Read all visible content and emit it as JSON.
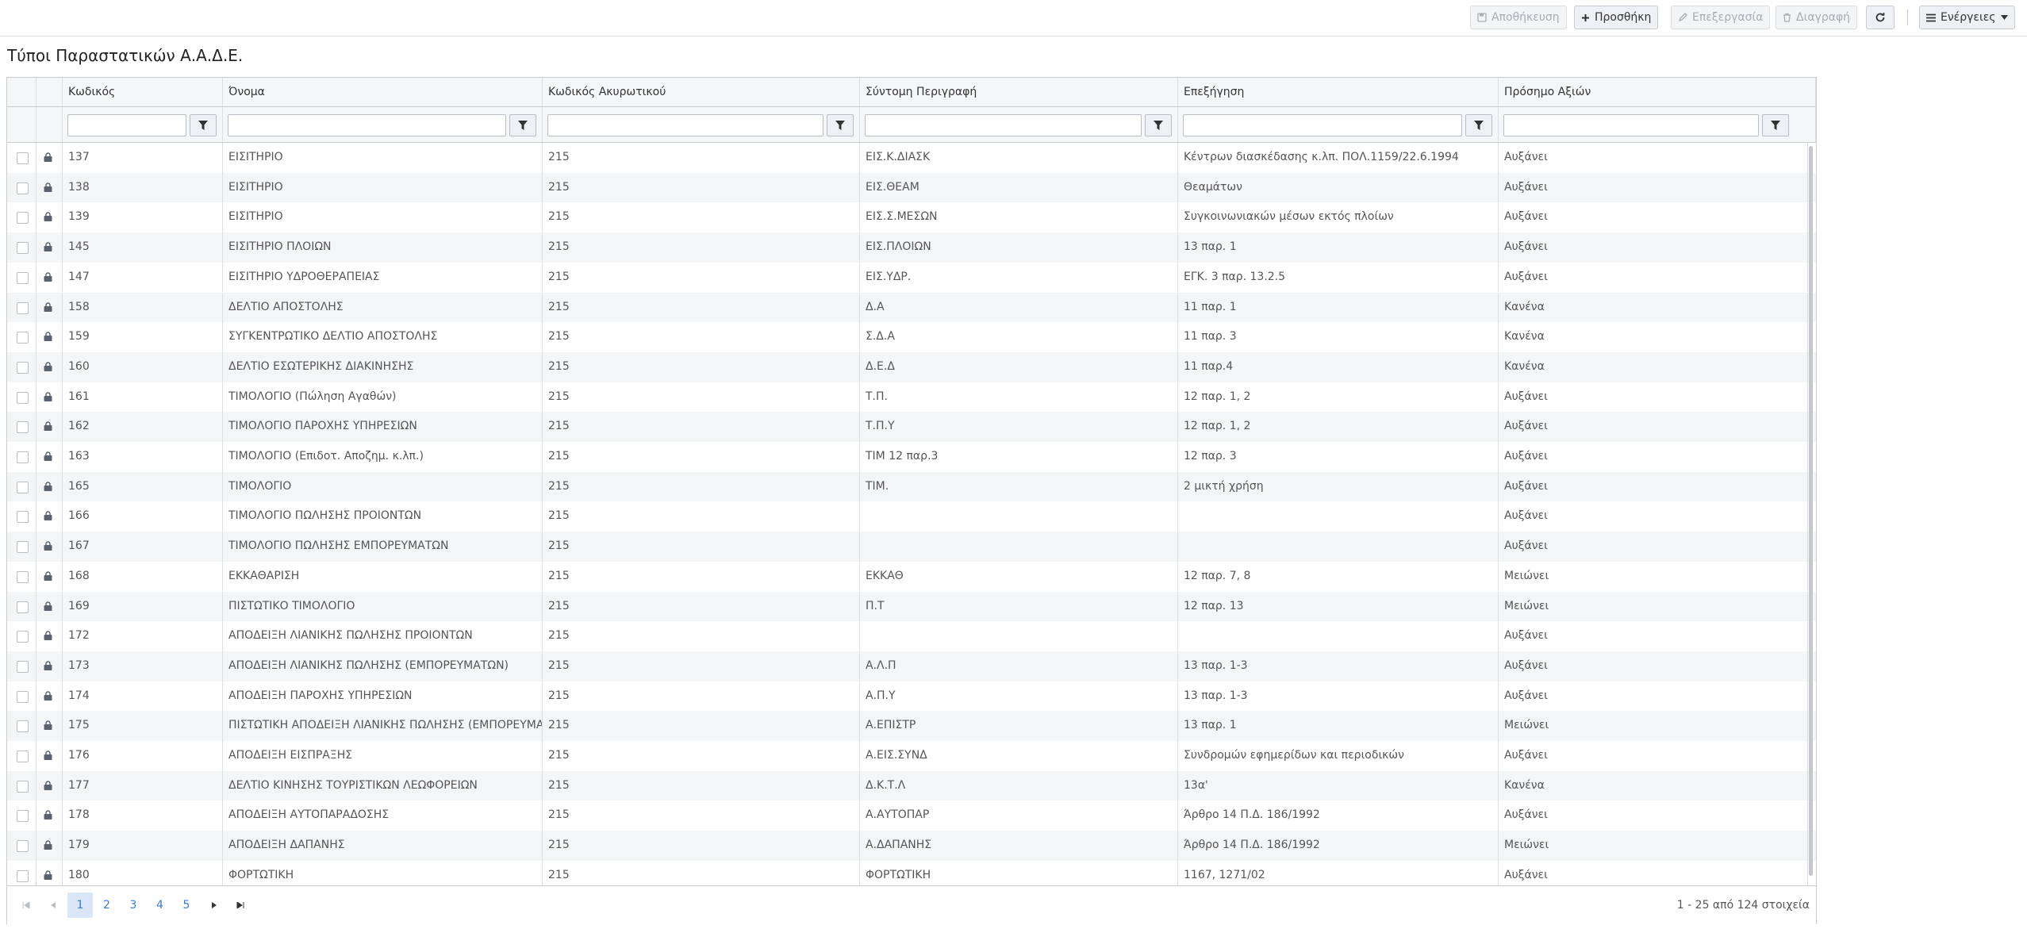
{
  "toolbar": {
    "save_label": "Αποθήκευση",
    "add_label": "Προσθήκη",
    "edit_label": "Επεξεργασία",
    "delete_label": "Διαγραφή",
    "actions_label": "Ενέργειες"
  },
  "page": {
    "title": "Τύποι Παραστατικών Α.Α.Δ.Ε."
  },
  "grid": {
    "columns": [
      "Κωδικός",
      "Όνομα",
      "Κωδικός Ακυρωτικού",
      "Σύντομη Περιγραφή",
      "Επεξήγηση",
      "Πρόσημο Αξιών"
    ],
    "rows": [
      [
        "137",
        "ΕΙΣΙΤΗΡΙΟ",
        "215",
        "ΕΙΣ.Κ.ΔΙΑΣΚ",
        "Κέντρων διασκέδασης κ.λπ. ΠΟΛ.1159/22.6.1994",
        "Αυξάνει"
      ],
      [
        "138",
        "ΕΙΣΙΤΗΡΙΟ",
        "215",
        "ΕΙΣ.ΘΕΑΜ",
        "Θεαμάτων",
        "Αυξάνει"
      ],
      [
        "139",
        "ΕΙΣΙΤΗΡΙΟ",
        "215",
        "ΕΙΣ.Σ.ΜΕΣΩΝ",
        "Συγκοινωνιακών μέσων εκτός πλοίων",
        "Αυξάνει"
      ],
      [
        "145",
        "ΕΙΣΙΤΗΡΙΟ ΠΛΟΙΩΝ",
        "215",
        "ΕΙΣ.ΠΛΟΙΩΝ",
        "13 παρ. 1",
        "Αυξάνει"
      ],
      [
        "147",
        "ΕΙΣΙΤΗΡΙΟ ΥΔΡΟΘΕΡΑΠΕΙΑΣ",
        "215",
        "ΕΙΣ.ΥΔΡ.",
        "ΕΓΚ. 3 παρ. 13.2.5",
        "Αυξάνει"
      ],
      [
        "158",
        "ΔΕΛΤΙΟ ΑΠΟΣΤΟΛΗΣ",
        "215",
        "Δ.Α",
        "11 παρ. 1",
        "Κανένα"
      ],
      [
        "159",
        "ΣΥΓΚΕΝΤΡΩΤΙΚΟ ΔΕΛΤΙΟ ΑΠΟΣΤΟΛΗΣ",
        "215",
        "Σ.Δ.Α",
        "11 παρ. 3",
        "Κανένα"
      ],
      [
        "160",
        "ΔΕΛΤΙΟ ΕΣΩΤΕΡΙΚΗΣ ΔΙΑΚΙΝΗΣΗΣ",
        "215",
        "Δ.Ε.Δ",
        "11 παρ.4",
        "Κανένα"
      ],
      [
        "161",
        "ΤΙΜΟΛΟΓΙΟ (Πώληση Αγαθών)",
        "215",
        "Τ.Π.",
        "12 παρ. 1, 2",
        "Αυξάνει"
      ],
      [
        "162",
        "ΤΙΜΟΛΟΓΙΟ ΠΑΡΟΧΗΣ ΥΠΗΡΕΣΙΩΝ",
        "215",
        "Τ.Π.Υ",
        "12 παρ. 1, 2",
        "Αυξάνει"
      ],
      [
        "163",
        "ΤΙΜΟΛΟΓΙΟ (Επιδοτ. Αποζημ. κ.λπ.)",
        "215",
        "ΤΙΜ 12 παρ.3",
        "12 παρ. 3",
        "Αυξάνει"
      ],
      [
        "165",
        "ΤΙΜΟΛΟΓΙΟ",
        "215",
        "ΤΙΜ.",
        "2 μικτή χρήση",
        "Αυξάνει"
      ],
      [
        "166",
        "ΤΙΜΟΛΟΓΙΟ ΠΩΛΗΣΗΣ ΠΡΟΙΟΝΤΩΝ",
        "215",
        "",
        "",
        "Αυξάνει"
      ],
      [
        "167",
        "ΤΙΜΟΛΟΓΙΟ ΠΩΛΗΣΗΣ ΕΜΠΟΡΕΥΜΑΤΩΝ",
        "215",
        "",
        "",
        "Αυξάνει"
      ],
      [
        "168",
        "ΕΚΚΑΘΑΡΙΣΗ",
        "215",
        "ΕΚΚΑΘ",
        "12 παρ. 7, 8",
        "Μειώνει"
      ],
      [
        "169",
        "ΠΙΣΤΩΤΙΚΟ ΤΙΜΟΛΟΓΙΟ",
        "215",
        "Π.Τ",
        "12 παρ. 13",
        "Μειώνει"
      ],
      [
        "172",
        "ΑΠΟΔΕΙΞΗ ΛΙΑΝΙΚΗΣ ΠΩΛΗΣΗΣ ΠΡΟΙΟΝΤΩΝ",
        "215",
        "",
        "",
        "Αυξάνει"
      ],
      [
        "173",
        "ΑΠΟΔΕΙΞΗ ΛΙΑΝΙΚΗΣ ΠΩΛΗΣΗΣ (ΕΜΠΟΡΕΥΜΑΤΩΝ)",
        "215",
        "Α.Λ.Π",
        "13 παρ. 1-3",
        "Αυξάνει"
      ],
      [
        "174",
        "ΑΠΟΔΕΙΞΗ ΠΑΡΟΧΗΣ ΥΠΗΡΕΣΙΩΝ",
        "215",
        "Α.Π.Υ",
        "13 παρ. 1-3",
        "Αυξάνει"
      ],
      [
        "175",
        "ΠΙΣΤΩΤΙΚΗ ΑΠΟΔΕΙΞΗ ΛΙΑΝΙΚΗΣ ΠΩΛΗΣΗΣ (ΕΜΠΟΡΕΥΜΑΤΩΝ)",
        "215",
        "Α.ΕΠΙΣΤΡ",
        "13 παρ. 1",
        "Μειώνει"
      ],
      [
        "176",
        "ΑΠΟΔΕΙΞΗ ΕΙΣΠΡΑΞΗΣ",
        "215",
        "Α.ΕΙΣ.ΣΥΝΔ",
        "Συνδρομών εφημερίδων και περιοδικών",
        "Αυξάνει"
      ],
      [
        "177",
        "ΔΕΛΤΙΟ ΚΙΝΗΣΗΣ ΤΟΥΡΙΣΤΙΚΩΝ ΛΕΩΦΟΡΕΙΩΝ",
        "215",
        "Δ.Κ.Τ.Λ",
        "13α'",
        "Κανένα"
      ],
      [
        "178",
        "ΑΠΟΔΕΙΞΗ ΑΥΤΟΠΑΡΑΔΟΣΗΣ",
        "215",
        "Α.ΑΥΤΟΠΑΡ",
        "Άρθρο 14 Π.Δ. 186/1992",
        "Αυξάνει"
      ],
      [
        "179",
        "ΑΠΟΔΕΙΞΗ ΔΑΠΑΝΗΣ",
        "215",
        "Α.ΔΑΠΑΝΗΣ",
        "Άρθρο 14 Π.Δ. 186/1992",
        "Μειώνει"
      ],
      [
        "180",
        "ΦΟΡΤΩΤΙΚΗ",
        "215",
        "ΦΟΡΤΩΤΙΚΗ",
        "1167, 1271/02",
        "Αυξάνει"
      ]
    ]
  },
  "pager": {
    "pages": [
      "1",
      "2",
      "3",
      "4",
      "5"
    ],
    "current_page": "1",
    "info": "1 - 25 από 124 στοιχεία"
  }
}
